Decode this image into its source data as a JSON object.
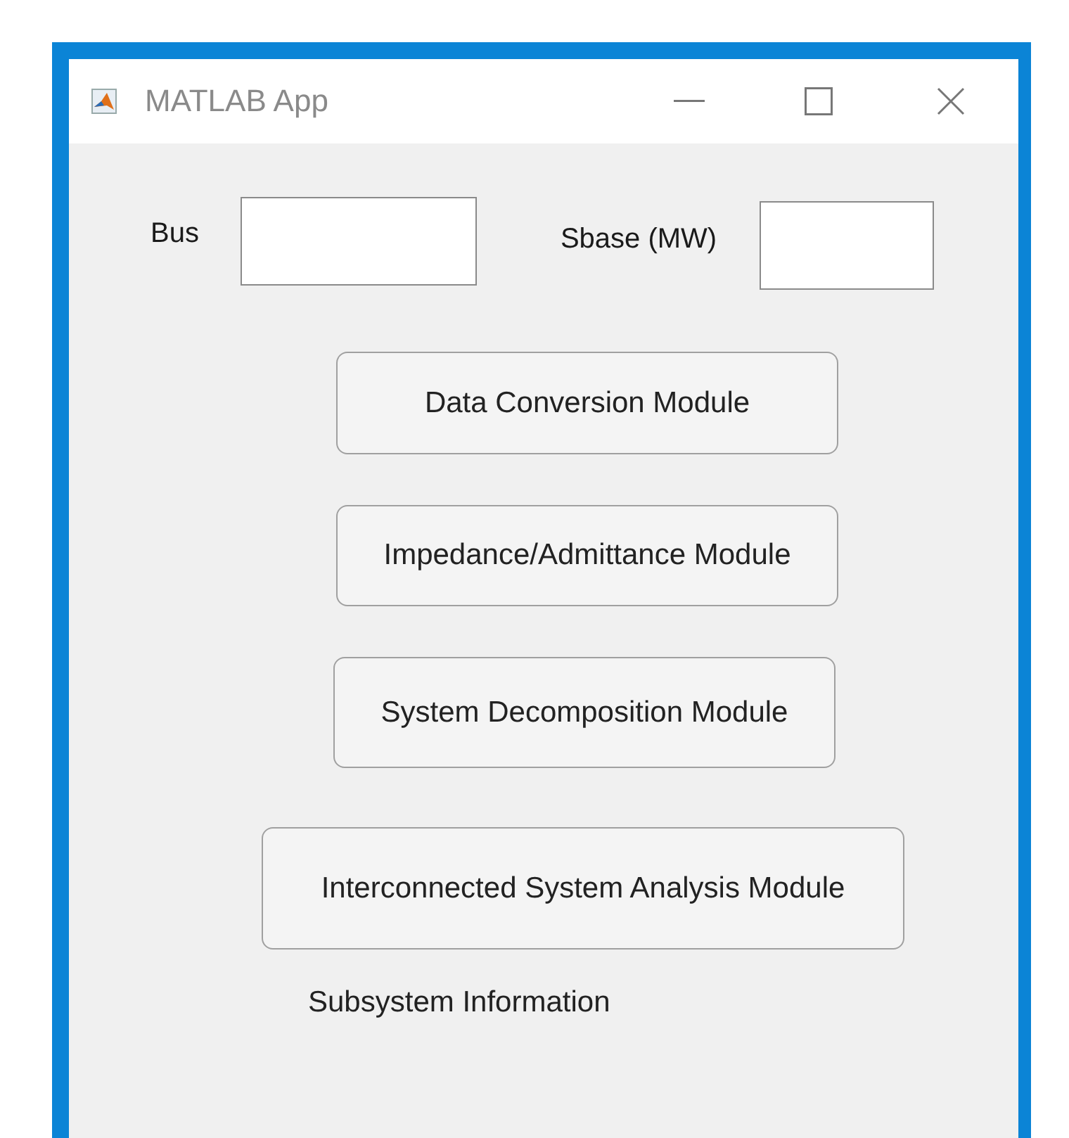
{
  "window": {
    "title": "MATLAB App"
  },
  "fields": [
    {
      "label": "Bus"
    },
    {
      "label": "Sbase (MW)"
    }
  ],
  "buttons": [
    "Data Conversion Module",
    "Impedance/Admittance Module",
    "System Decomposition Module",
    "Interconnected System Analysis Module"
  ],
  "info_label": "Subsystem Information"
}
